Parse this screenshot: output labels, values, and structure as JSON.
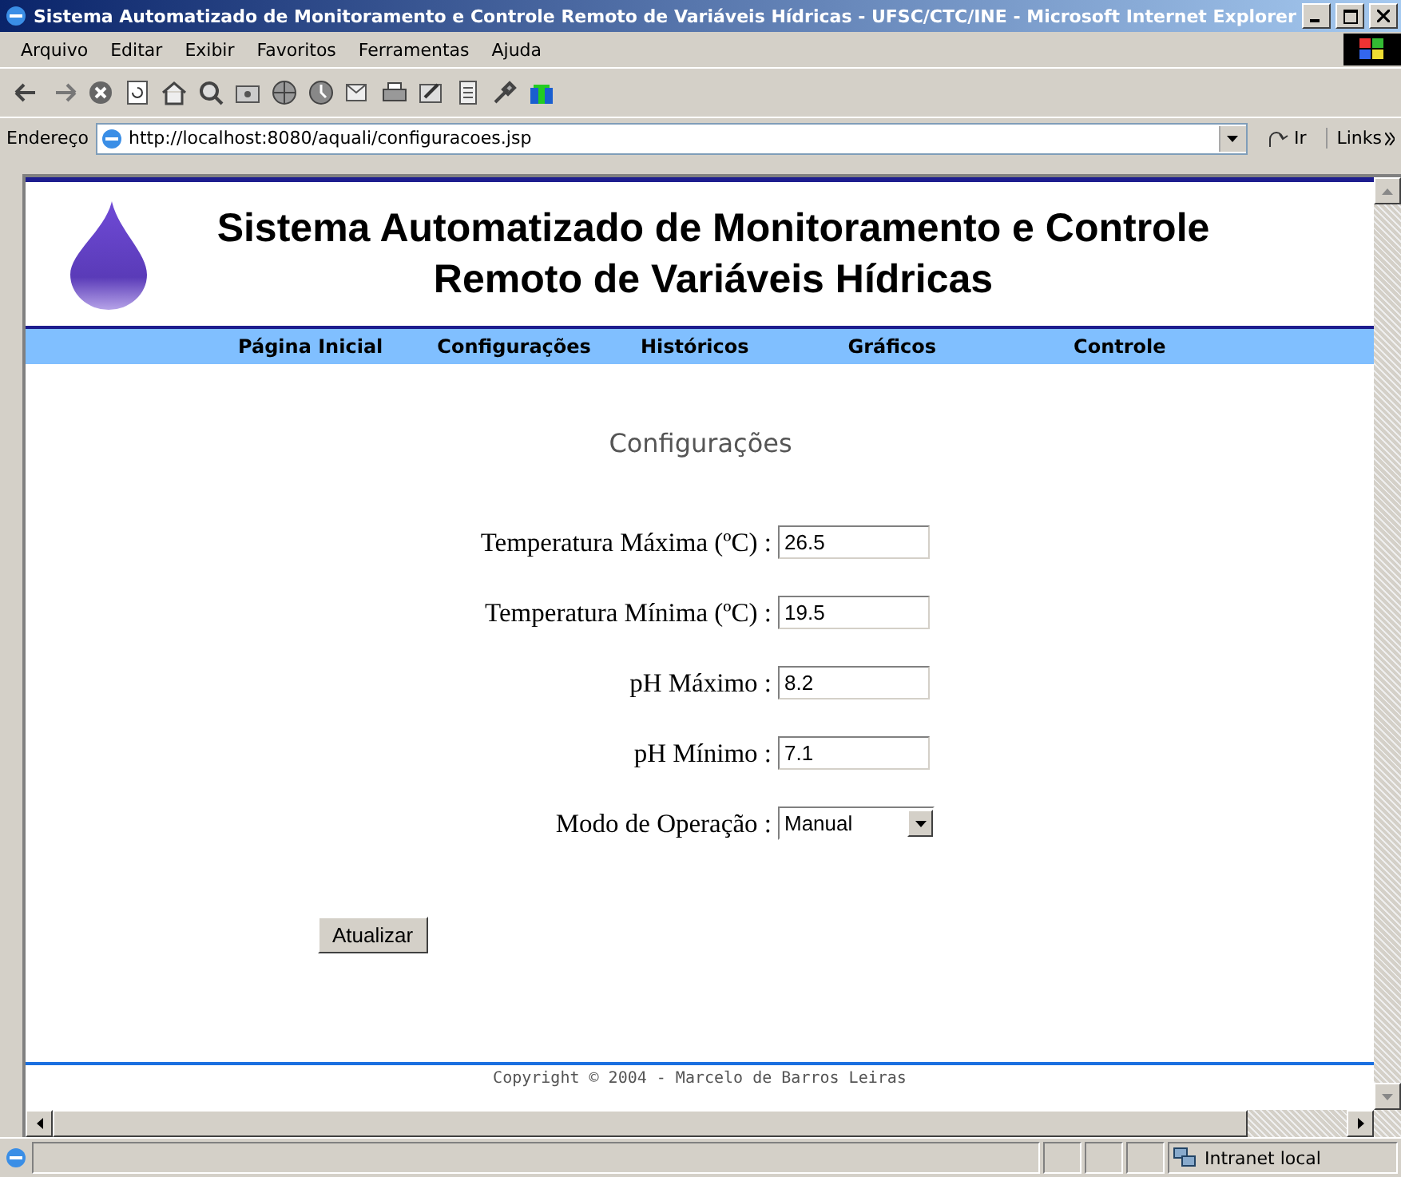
{
  "window": {
    "title": "Sistema Automatizado de Monitoramento e Controle Remoto de Variáveis Hídricas - UFSC/CTC/INE - Microsoft Internet Explorer"
  },
  "menu": [
    "Arquivo",
    "Editar",
    "Exibir",
    "Favoritos",
    "Ferramentas",
    "Ajuda"
  ],
  "address": {
    "label": "Endereço",
    "url": "http://localhost:8080/aquali/configuracoes.jsp",
    "go": "Ir",
    "links": "Links"
  },
  "site": {
    "title_lines": [
      "Sistema Automatizado de Monitoramento e Controle",
      "Remoto de Variáveis Hídricas"
    ],
    "nav": [
      "Página Inicial",
      "Configurações",
      "Históricos",
      "Gráficos",
      "Controle"
    ]
  },
  "form": {
    "heading": "Configurações",
    "fields": [
      {
        "kind": "text",
        "label": "Temperatura Máxima (ºC) :",
        "value": "26.5"
      },
      {
        "kind": "text",
        "label": "Temperatura Mínima (ºC) :",
        "value": "19.5"
      },
      {
        "kind": "text",
        "label": "pH Máximo :",
        "value": "8.2"
      },
      {
        "kind": "text",
        "label": "pH Mínimo :",
        "value": "7.1"
      },
      {
        "kind": "select",
        "label": "Modo de Operação :",
        "value": "Manual"
      }
    ],
    "submit": "Atualizar"
  },
  "footer": "Copyright © 2004 - Marcelo de Barros Leiras",
  "status_bar": {
    "zone": "Intranet local"
  }
}
